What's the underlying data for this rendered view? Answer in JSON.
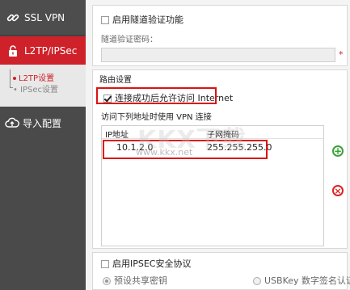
{
  "sidebar": {
    "items": [
      {
        "label": "SSL VPN",
        "icon": "link-icon"
      },
      {
        "label": "L2TP/IPSec",
        "icon": "lock-icon"
      },
      {
        "label": "导入配置",
        "icon": "cloud-upload-icon"
      }
    ],
    "subitems": [
      {
        "label": "L2TP设置"
      },
      {
        "label": "IPSec设置"
      }
    ]
  },
  "main": {
    "tunnel_auth_label": "启用隧道验证功能",
    "tunnel_password_label": "隧道验证密码：",
    "tunnel_password_value": "",
    "required_mark": "*",
    "routing_section_title": "路由设置",
    "allow_internet_label": "连接成功后允许访问 Internet",
    "vpn_access_label": "访问下列地址时使用 VPN 连接",
    "table": {
      "headers": [
        "IP地址",
        "子网掩码"
      ],
      "rows": [
        {
          "ip": "10.1.2.0",
          "mask": "255.255.255.0"
        }
      ]
    },
    "ipsec_enable_label": "启用IPSEC安全协议",
    "psk_label": "预设共享密钥",
    "usbkey_label": "USBKey 数字签名认证"
  },
  "watermark": {
    "text": "KKX下载",
    "url": "www.kkx.net"
  },
  "colors": {
    "accent": "#cf2129",
    "sidebar": "#4a4a4a",
    "highlight_box": "#dd1111",
    "add": "#3aa23a",
    "delete": "#dd2222"
  }
}
